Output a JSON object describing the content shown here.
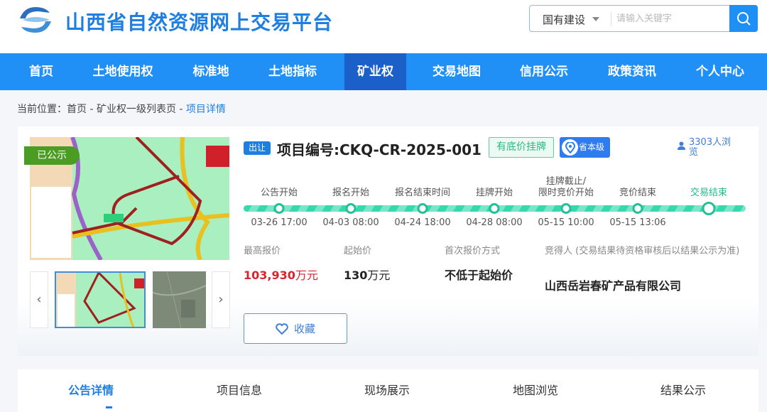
{
  "header": {
    "title": "山西省自然资源网上交易平台",
    "search": {
      "category": "国有建设",
      "placeholder": "请输入关键字"
    }
  },
  "nav": {
    "items": [
      {
        "label": "首页"
      },
      {
        "label": "土地使用权"
      },
      {
        "label": "标准地"
      },
      {
        "label": "土地指标"
      },
      {
        "label": "矿业权",
        "active": true
      },
      {
        "label": "交易地图"
      },
      {
        "label": "信用公示"
      },
      {
        "label": "政策资讯"
      },
      {
        "label": "个人中心"
      }
    ]
  },
  "breadcrumb": {
    "prefix": "当前位置：",
    "items": [
      "首页",
      "矿业权一级列表页"
    ],
    "sep": " - ",
    "current": "项目详情"
  },
  "project": {
    "status_badge": "已公示",
    "type_tag": "出让",
    "number": "项目编号:CKQ-CR-2025-001",
    "reserve_tag": "有底价挂牌",
    "level_tag": "省本级",
    "views": "3303人浏览",
    "timeline": [
      {
        "label": "公告开始",
        "date": "03-26 17:00"
      },
      {
        "label": "报名开始",
        "date": "04-03 08:00"
      },
      {
        "label": "报名结束时间",
        "date": "04-24 18:00"
      },
      {
        "label": "挂牌开始",
        "date": "04-28 08:00"
      },
      {
        "label": "挂牌截止/\n限时竞价开始",
        "date": "05-15 10:00"
      },
      {
        "label": "竞价结束",
        "date": "05-15 13:06"
      },
      {
        "label": "交易结束",
        "date": ""
      }
    ],
    "info": {
      "max_price_label": "最高报价",
      "max_price": "103,930",
      "max_price_unit": "万元",
      "start_price_label": "起始价",
      "start_price": "130",
      "start_price_unit": "万元",
      "first_bid_label": "首次报价方式",
      "first_bid": "不低于起始价",
      "winner_label": "竞得人 (交易结果待资格审核后以结果公示为准)",
      "winner": "山西岳岩春矿产品有限公司"
    },
    "favorite_label": "收藏"
  },
  "tabs": [
    {
      "label": "公告详情",
      "active": true
    },
    {
      "label": "项目信息"
    },
    {
      "label": "现场展示"
    },
    {
      "label": "地图浏览"
    },
    {
      "label": "结果公示"
    }
  ],
  "colors": {
    "primary": "#2090f6",
    "nav_active": "#1b5fc9",
    "price_red": "#d9232e",
    "progress": "#36d8ad"
  }
}
